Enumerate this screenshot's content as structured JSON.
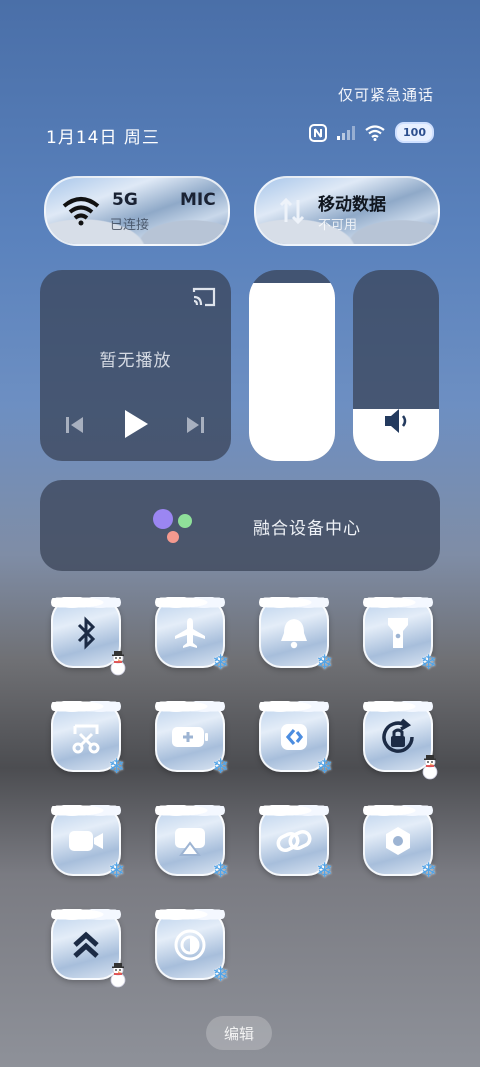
{
  "status_bar": {
    "emergency_text": "仅可紧急通话",
    "date": "1月14日 周三",
    "battery": "100",
    "icons": [
      "nfc-icon",
      "signal-icon",
      "wifi-icon",
      "battery-icon"
    ]
  },
  "wifi_tile": {
    "title": "5G",
    "title_partial": "MIC",
    "subtitle": "已连接"
  },
  "data_tile": {
    "title": "移动数据",
    "subtitle": "不可用"
  },
  "media": {
    "status": "暂无播放"
  },
  "sliders": {
    "brightness_level": 0.93,
    "volume_level": 0.27
  },
  "hub": {
    "label": "融合设备中心"
  },
  "tiles": [
    {
      "name": "bluetooth",
      "icon": "bluetooth-icon"
    },
    {
      "name": "airplane-mode",
      "icon": "airplane-icon"
    },
    {
      "name": "ring-mode",
      "icon": "bell-icon"
    },
    {
      "name": "flashlight",
      "icon": "flashlight-icon"
    },
    {
      "name": "screenshot",
      "icon": "scissors-screenshot-icon"
    },
    {
      "name": "battery-saver",
      "icon": "battery-plus-icon"
    },
    {
      "name": "nearby-share",
      "icon": "share-arrows-icon"
    },
    {
      "name": "rotation-lock",
      "icon": "rotation-lock-icon"
    },
    {
      "name": "screen-record",
      "icon": "video-camera-icon"
    },
    {
      "name": "screen-cast",
      "icon": "cast-screen-icon"
    },
    {
      "name": "link-share",
      "icon": "link-icon"
    },
    {
      "name": "settings",
      "icon": "hexagon-settings-icon"
    },
    {
      "name": "performance-mode",
      "icon": "double-chevron-up-icon"
    },
    {
      "name": "dark-mode",
      "icon": "contrast-circle-icon"
    }
  ],
  "edit_button": {
    "label": "编辑"
  },
  "colors": {
    "accent_blue": "#4fa3e8",
    "card_bg": "#374155",
    "battery_text": "#2d4f8e"
  }
}
